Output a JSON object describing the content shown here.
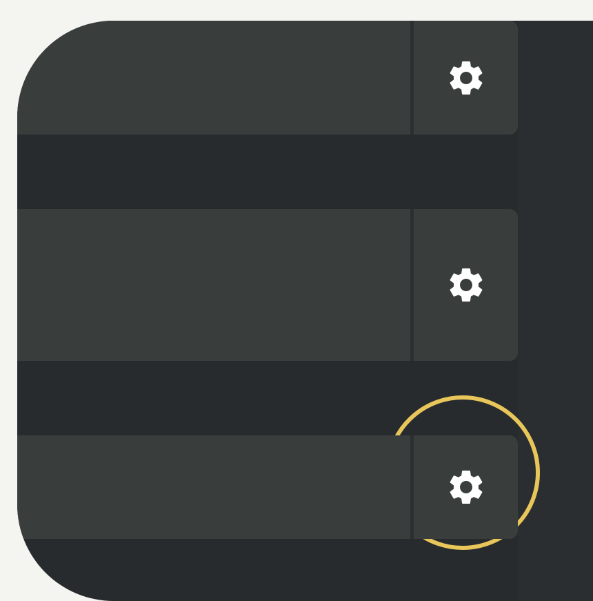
{
  "rows": [
    {
      "settings_icon": "gear-icon"
    },
    {
      "settings_icon": "gear-icon",
      "highlighted": true
    },
    {
      "settings_icon": "gear-icon"
    }
  ],
  "colors": {
    "page_background": "#f4f4f1",
    "panel_background": "#272b2e",
    "row_background": "#393e3d",
    "icon_color": "#ffffff",
    "highlight_ring": "#e8c65a"
  }
}
